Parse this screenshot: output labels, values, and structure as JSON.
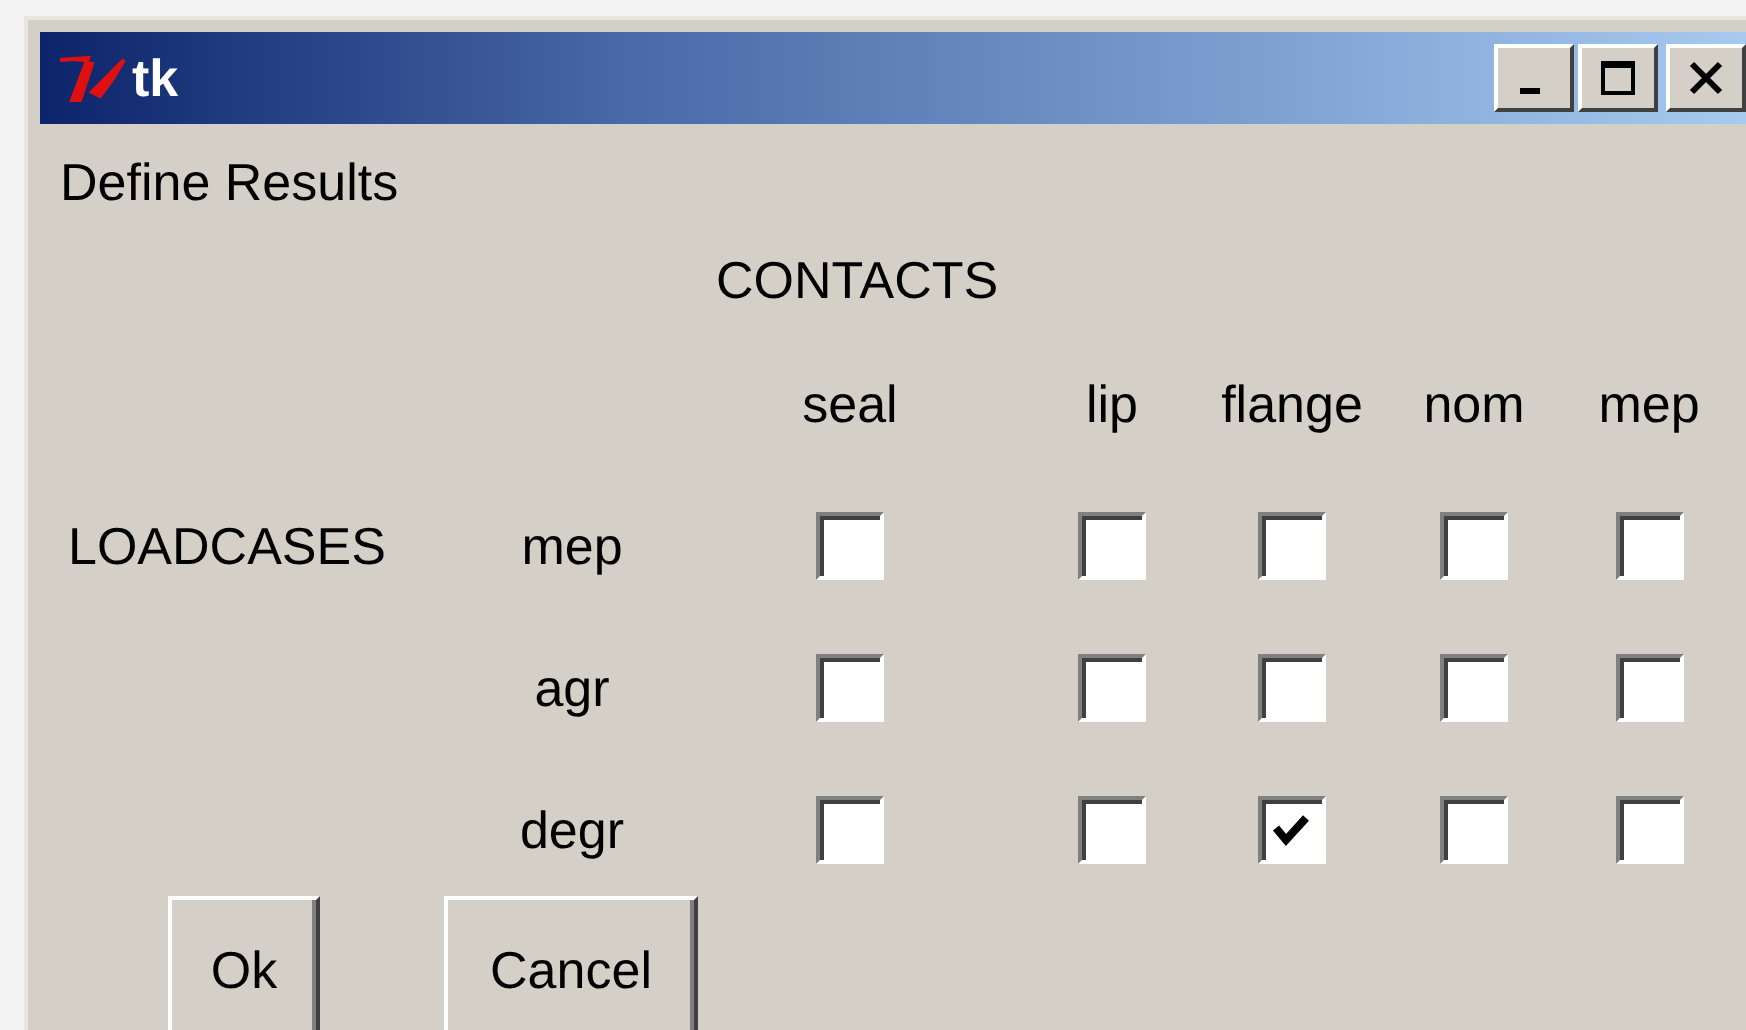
{
  "window": {
    "title": "tk"
  },
  "heading": "Define Results",
  "column_group_label": "CONTACTS",
  "row_group_label": "LOADCASES",
  "columns": [
    "seal",
    "lip",
    "flange",
    "nom",
    "mep"
  ],
  "rows": [
    {
      "label": "mep",
      "checks": [
        {
          "checked": false
        },
        {
          "checked": false
        },
        {
          "checked": false
        },
        {
          "checked": false
        },
        {
          "checked": false
        }
      ]
    },
    {
      "label": "agr",
      "checks": [
        {
          "checked": false
        },
        {
          "checked": false
        },
        {
          "checked": false
        },
        {
          "checked": false
        },
        {
          "checked": false
        }
      ]
    },
    {
      "label": "degr",
      "checks": [
        {
          "checked": false
        },
        {
          "checked": false
        },
        {
          "checked": true
        },
        {
          "checked": false
        },
        {
          "checked": false
        }
      ]
    }
  ],
  "buttons": [
    "Ok",
    "Cancel"
  ]
}
